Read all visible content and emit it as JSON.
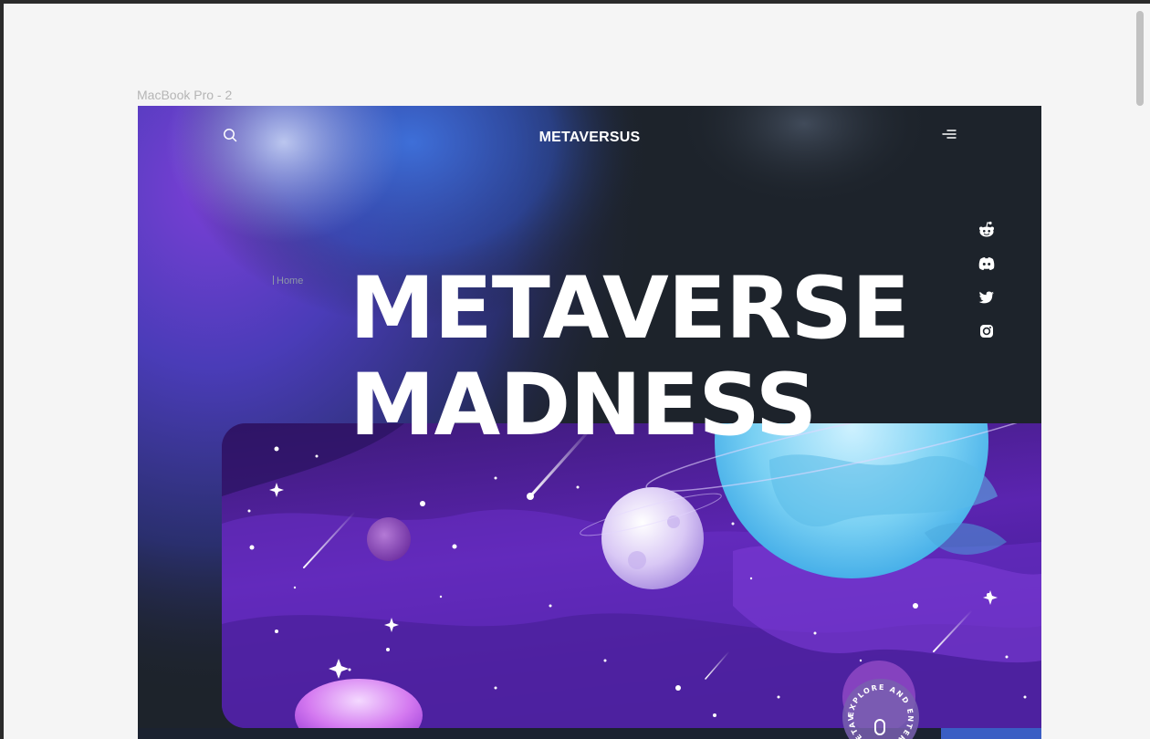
{
  "frame_label": "MacBook Pro - 2",
  "brand": "METAVERSUS",
  "breadcrumb": "Home",
  "title_lines": [
    "METAVERSE",
    "MADNESS"
  ],
  "badge_text": "EXPLORE AND ENTER THE METAVERSE",
  "icons": {
    "search": "search-icon",
    "menu": "menu-icon",
    "social": [
      "reddit-icon",
      "discord-icon",
      "twitter-icon",
      "instagram-icon"
    ],
    "scroll": "mouse-icon"
  },
  "colors": {
    "canvas_bg": "#f5f5f5",
    "hero_bg": "#1d232b",
    "accent_purple": "#7b2ff7",
    "planet_blue": "#7fd3f2",
    "white": "#ffffff"
  }
}
